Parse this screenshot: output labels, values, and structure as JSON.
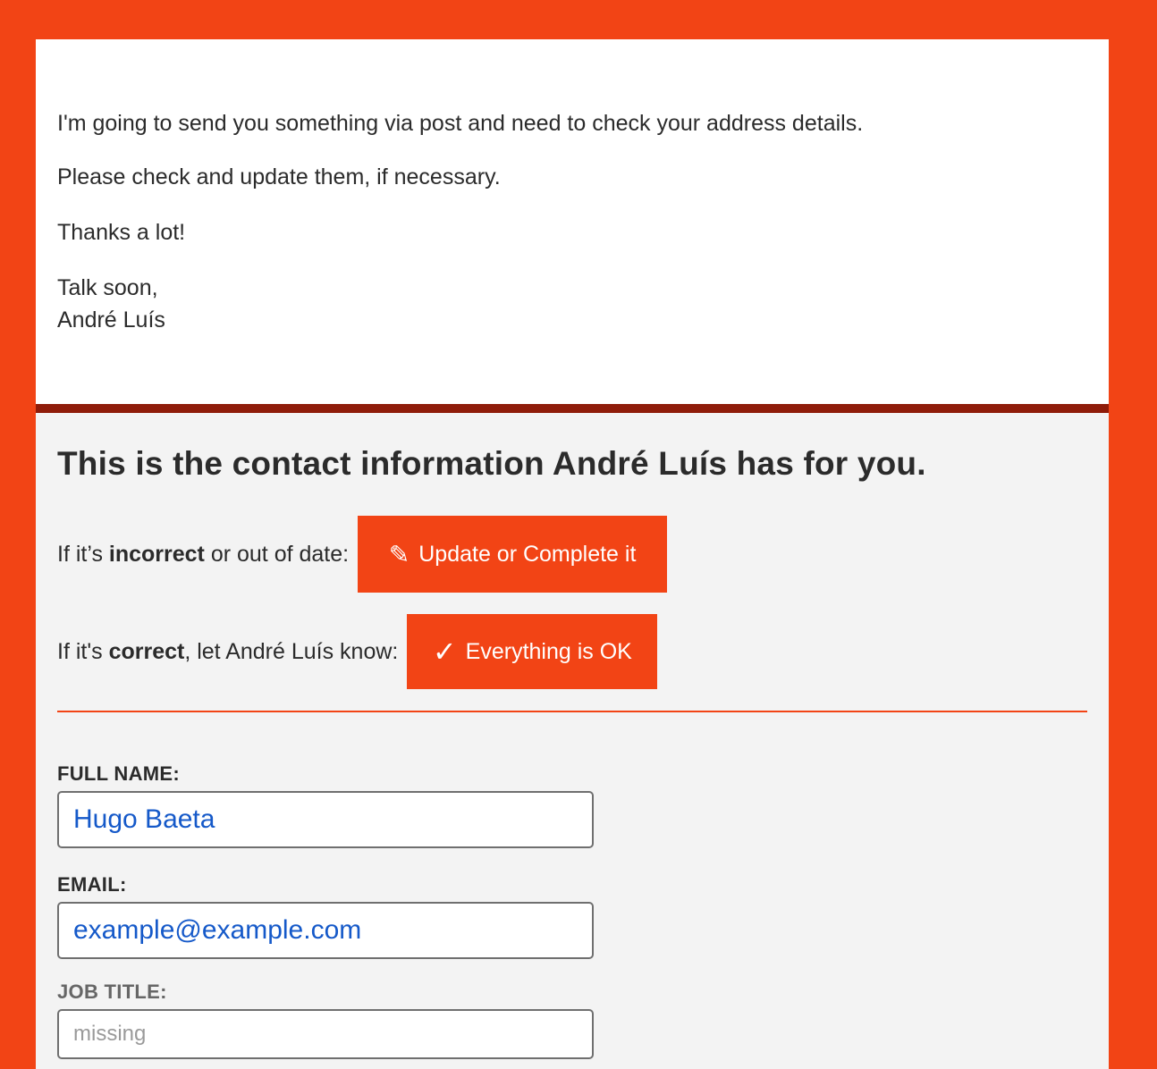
{
  "message": {
    "line1": "I'm going to send you something via post and need to check your address details.",
    "line2": "Please check and update them, if necessary.",
    "line3": "Thanks a lot!",
    "signoff": "Talk soon,",
    "signature": "André Luís"
  },
  "contact": {
    "title": "This is the contact information André Luís has for you.",
    "update_row": {
      "prefix": "If it’s ",
      "bold": "incorrect",
      "suffix": " or out of date:",
      "button_icon": "pencil-icon",
      "button_glyph": "✎",
      "button_label": "Update or Complete it"
    },
    "ok_row": {
      "prefix": "If it's ",
      "bold": "correct",
      "suffix": ", let André Luís know:",
      "button_icon": "checkmark-icon",
      "button_glyph": "✓",
      "button_label": "Everything is OK"
    },
    "fields": [
      {
        "label": "FULL NAME:",
        "value": "Hugo Baeta",
        "placeholder": ""
      },
      {
        "label": "EMAIL:",
        "value": "example@example.com",
        "placeholder": ""
      },
      {
        "label": "JOB TITLE:",
        "value": "",
        "placeholder": "missing"
      }
    ]
  },
  "colors": {
    "accent": "#f24415",
    "divider": "#8f1c0a",
    "field_value": "#1559c9"
  }
}
